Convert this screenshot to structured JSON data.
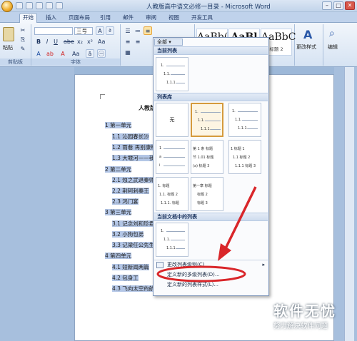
{
  "window": {
    "title": "人教版高中语文必修一目录 - Microsoft Word"
  },
  "tabs": [
    "开始",
    "插入",
    "页面布局",
    "引用",
    "邮件",
    "审阅",
    "视图",
    "开发工具"
  ],
  "ribbon": {
    "paste_label": "粘贴",
    "clipboard_group": "剪贴板",
    "font_group": "字体",
    "font_size": "三号",
    "styles": [
      {
        "sample": "AaBb(",
        "name": ""
      },
      {
        "sample": "AaBl",
        "name": ""
      },
      {
        "sample": "AaBbC",
        "name": "标题 2"
      }
    ],
    "change_styles": "更改样式",
    "edit_label": "编辑"
  },
  "document": {
    "title": "人教版",
    "lines": [
      {
        "text": "1 第一单元"
      },
      {
        "text": "1.1 沁园春长沙"
      },
      {
        "text": "1.2 雨巷 再别康桥"
      },
      {
        "text": "1.3 大堰河——我的"
      },
      {
        "text": "2 第二单元"
      },
      {
        "text": "2.1 烛之武退秦师"
      },
      {
        "text": "2.2 荆轲刺秦王"
      },
      {
        "text": "2.3 鸿门宴"
      },
      {
        "text": "3 第三单元"
      },
      {
        "text": "3.1 记念刘和珍君"
      },
      {
        "text": "3.2 小狗包弟"
      },
      {
        "text": "3.3 记梁任公先生"
      },
      {
        "text": "4 第四单元"
      },
      {
        "text": "4.1 短新闻两篇"
      },
      {
        "text": "4.2 包身工"
      },
      {
        "text": "4.3 飞向太空的航"
      }
    ]
  },
  "dropdown": {
    "tab_label": "全部",
    "current_list": "当前列表",
    "list_library": "列表库",
    "none_label": "无",
    "in_document": "当前文档中的列表",
    "menu_items": [
      "更改列表级别(C)",
      "定义新的多级列表(D)...",
      "定义新的列表样式(L)..."
    ],
    "thumbs": {
      "cur": [
        "1.",
        "1.1.",
        "1.1.1."
      ],
      "l1": [
        "1.",
        "1.1.",
        "1.1.1."
      ],
      "l2": [
        "1.",
        "1.1.",
        "1.1.1."
      ],
      "l3": [
        "1",
        "a",
        "i"
      ],
      "l4": [
        "第 1 条 标题",
        "节 1.01 标题",
        "(a) 标题 3"
      ],
      "l5": [
        "1 标题 1",
        "1.1 标题 2",
        "1.1.1 标题 3"
      ],
      "l6": [
        "1. 标题",
        "1.1. 标题 2",
        "1.1.1. 标题"
      ],
      "l7": [
        "第一章 标题",
        "标题 2",
        "标题 3"
      ],
      "doc": [
        "1.",
        "1.1.",
        "1.1.1."
      ]
    }
  },
  "watermark": {
    "big": "软件无忧",
    "small": "努力解决软件问题"
  },
  "colors": {
    "highlight_ring": "#d9262a",
    "arrow": "#d9262a",
    "selection": "#b3c6e6"
  }
}
